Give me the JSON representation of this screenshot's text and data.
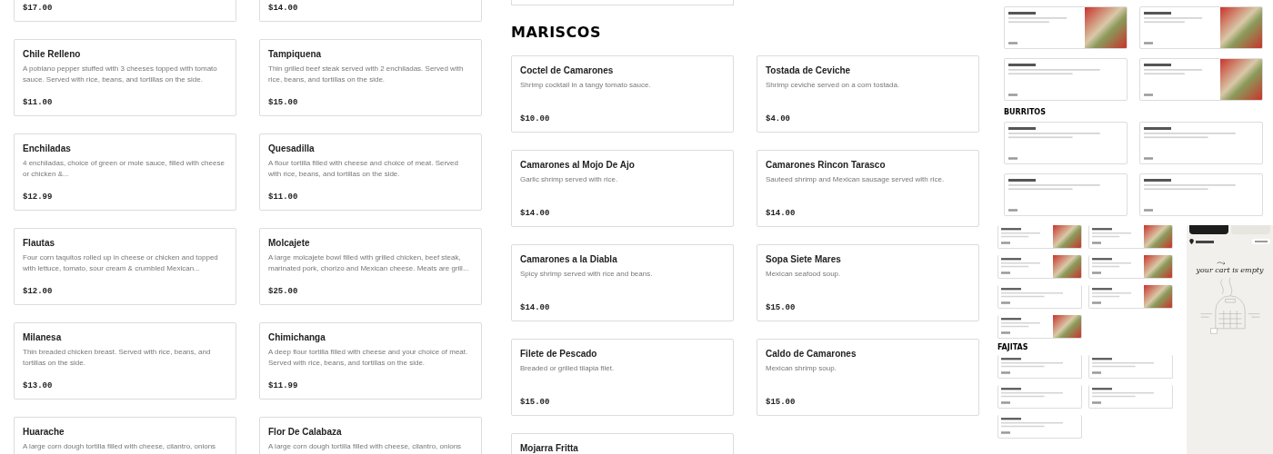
{
  "panels": [
    {
      "sections": [
        {
          "items": [
            {
              "price": "$17.00"
            },
            {
              "price": "$14.00"
            },
            {
              "name": "Chile Relleno",
              "description": "A poblano pepper stuffed with 3 cheeses topped with tomato sauce. Served with rice, beans, and tortillas on the side.",
              "price": "$11.00"
            },
            {
              "name": "Tampiquena",
              "description": "Thin grilled beef steak served with 2 enchiladas. Served with rice, beans, and tortillas on the side.",
              "price": "$15.00"
            },
            {
              "name": "Enchiladas",
              "description": "4 enchiladas, choice of green or mole sauce, filled with cheese or chicken &...",
              "price": "$12.99"
            },
            {
              "name": "Quesadilla",
              "description": "A flour tortilla filled with cheese and choice of meat. Served with rice, beans, and tortillas on the side.",
              "price": "$11.00"
            },
            {
              "name": "Flautas",
              "description": "Four corn taquitos rolled up in cheese or chicken and topped with lettuce, tomato, sour cream & crumbled Mexican...",
              "price": "$12.00"
            },
            {
              "name": "Molcajete",
              "description": "A large molcajete bowl filled with grilled chicken, beef steak, marinated pork, chorizo and Mexican cheese. Meats are grill...",
              "price": "$25.00"
            },
            {
              "name": "Milanesa",
              "description": "Thin breaded chicken breast. Served with rice, beans, and tortillas on the side.",
              "price": "$13.00"
            },
            {
              "name": "Chimichanga",
              "description": "A deep flour tortilla filled with cheese and your choice of meat. Served with rice, beans, and tortillas on the side.",
              "price": "$11.99"
            },
            {
              "name": "Huarache",
              "description": "A large corn dough tortilla filled with cheese, cilantro, onions"
            },
            {
              "name": "Flor De Calabaza",
              "description": "A large corn dough tortilla filled with cheese, cilantro, onions"
            }
          ]
        }
      ]
    },
    {
      "sections": [
        {
          "heading": "MARISCOS",
          "items": [
            {
              "name": "Coctel de Camarones",
              "description": "Shrimp cocktail in a tangy tomato sauce.",
              "price": "$10.00"
            },
            {
              "name": "Tostada de Ceviche",
              "description": "Shrimp ceviche served on a corn tostada.",
              "price": "$4.00"
            },
            {
              "name": "Camarones al Mojo De Ajo",
              "description": "Garlic shrimp served with rice.",
              "price": "$14.00"
            },
            {
              "name": "Camarones Rincon Tarasco",
              "description": "Sauteed shrimp and Mexican sausage served with rice.",
              "price": "$14.00"
            },
            {
              "name": "Camarones a la Diabla",
              "description": "Spicy shrimp served with rice and beans.",
              "price": "$14.00"
            },
            {
              "name": "Sopa Siete Mares",
              "description": "Mexican seafood soup.",
              "price": "$15.00"
            },
            {
              "name": "Filete de Pescado",
              "description": "Breaded or grilled tilapia filet.",
              "price": "$15.00"
            },
            {
              "name": "Caldo de Camarones",
              "description": "Mexican shrimp soup.",
              "price": "$15.00"
            },
            {
              "name": "Mojarra Fritta"
            }
          ]
        }
      ]
    },
    {
      "sections": [
        {
          "items": [
            {
              "photo": true
            },
            {
              "photo": true
            },
            {
              "photo": false
            },
            {
              "photo": true
            }
          ]
        },
        {
          "heading": "BURRITOS",
          "items": [
            {
              "photo": false
            },
            {
              "photo": false
            },
            {
              "photo": false
            },
            {
              "photo": false
            }
          ]
        }
      ]
    },
    {
      "sections": [
        {
          "items": [
            {
              "photo": true
            },
            {
              "photo": true
            },
            {
              "photo": true
            },
            {
              "photo": true
            },
            {
              "photo": false
            },
            {
              "photo": true
            },
            {
              "photo": true
            }
          ]
        },
        {
          "heading": "FAJITAS",
          "items": [
            {
              "photo": false
            },
            {
              "photo": false
            },
            {
              "photo": false
            },
            {
              "photo": false
            },
            {
              "photo": false
            }
          ]
        }
      ],
      "cart": {
        "tabs": [
          {
            "selected": true
          },
          {
            "selected": false
          }
        ],
        "message": "your cart is empty"
      }
    }
  ]
}
